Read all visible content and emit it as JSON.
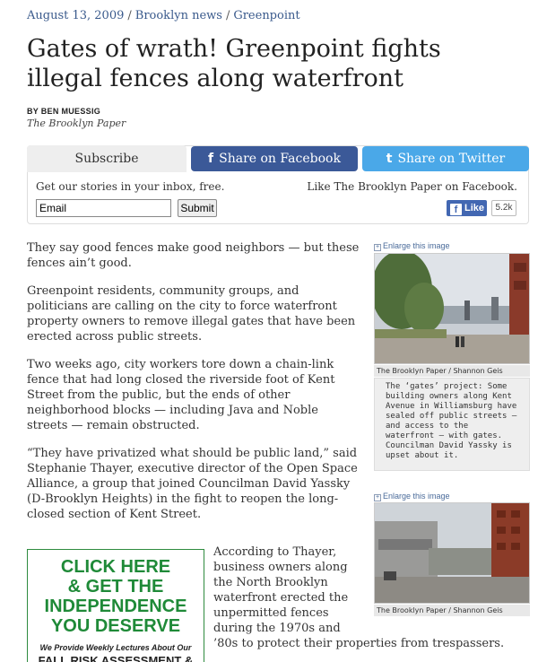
{
  "meta": {
    "date": "August 13, 2009",
    "section": "Brooklyn news",
    "subsection": "Greenpoint",
    "separator": "/"
  },
  "article": {
    "title": "Gates of wrath! Greenpoint fights illegal fences along waterfront",
    "byline": "BY BEN MUESSIG",
    "publication": "The Brooklyn Paper",
    "paragraphs": [
      "They say good fences make good neighbors — but these fences ain’t good.",
      "Greenpoint residents, community groups, and politicians are calling on the city to force waterfront property owners to remove illegal gates that have been erected across public streets.",
      "Two weeks ago, city workers tore down a chain-link fence that had long closed the riverside foot of Kent Street from the public, but the ends of other neighborhood blocks — including Java and Noble streets — remain obstructed.",
      "“They have privatized what should be public land,” said Stephanie Thayer, executive director of the Open Space Alliance, a group that joined Councilman David Yassky (D-Brooklyn Heights) in the fight to reopen the long-closed section of Kent Street."
    ],
    "continued_lines": [
      "According to Thayer,",
      "business owners along",
      "the North Brooklyn",
      "waterfront erected the",
      "unpermitted fences",
      "during the 1970s and",
      "’80s to protect their properties from trespassers."
    ]
  },
  "subscribe": {
    "tab_label": "Subscribe",
    "facebook_label": "Share on Facebook",
    "twitter_label": "Share on Twitter",
    "facebook_icon": "f",
    "twitter_icon": "t",
    "inbox_text": "Get our stories in your inbox, free.",
    "like_text": "Like The Brooklyn Paper on Facebook.",
    "email_value": "Email",
    "submit_label": "Submit",
    "like_button": "Like",
    "like_count": "5.2k"
  },
  "photos": [
    {
      "enlarge": "Enlarge this image",
      "credit": "The Brooklyn Paper / Shannon Geis",
      "caption": "The ‘gates’ project: Some building owners along Kent Avenue in Williamsburg have sealed off public streets — and access to the waterfront — with gates. Councilman David Yassky is upset about it."
    },
    {
      "enlarge": "Enlarge this image",
      "credit": "The Brooklyn Paper / Shannon Geis"
    }
  ],
  "ad": {
    "line1": "CLICK HERE",
    "line2": "& GET THE",
    "line3": "INDEPENDENCE",
    "line4": "YOU DESERVE",
    "small": "We Provide Weekly Lectures About Our",
    "bottom": "FALL RISK ASSESSMENT &"
  },
  "colors": {
    "link": "#3a5a8c",
    "facebook": "#3b5998",
    "twitter": "#4aa8e8",
    "ad_green": "#1f8a38"
  }
}
